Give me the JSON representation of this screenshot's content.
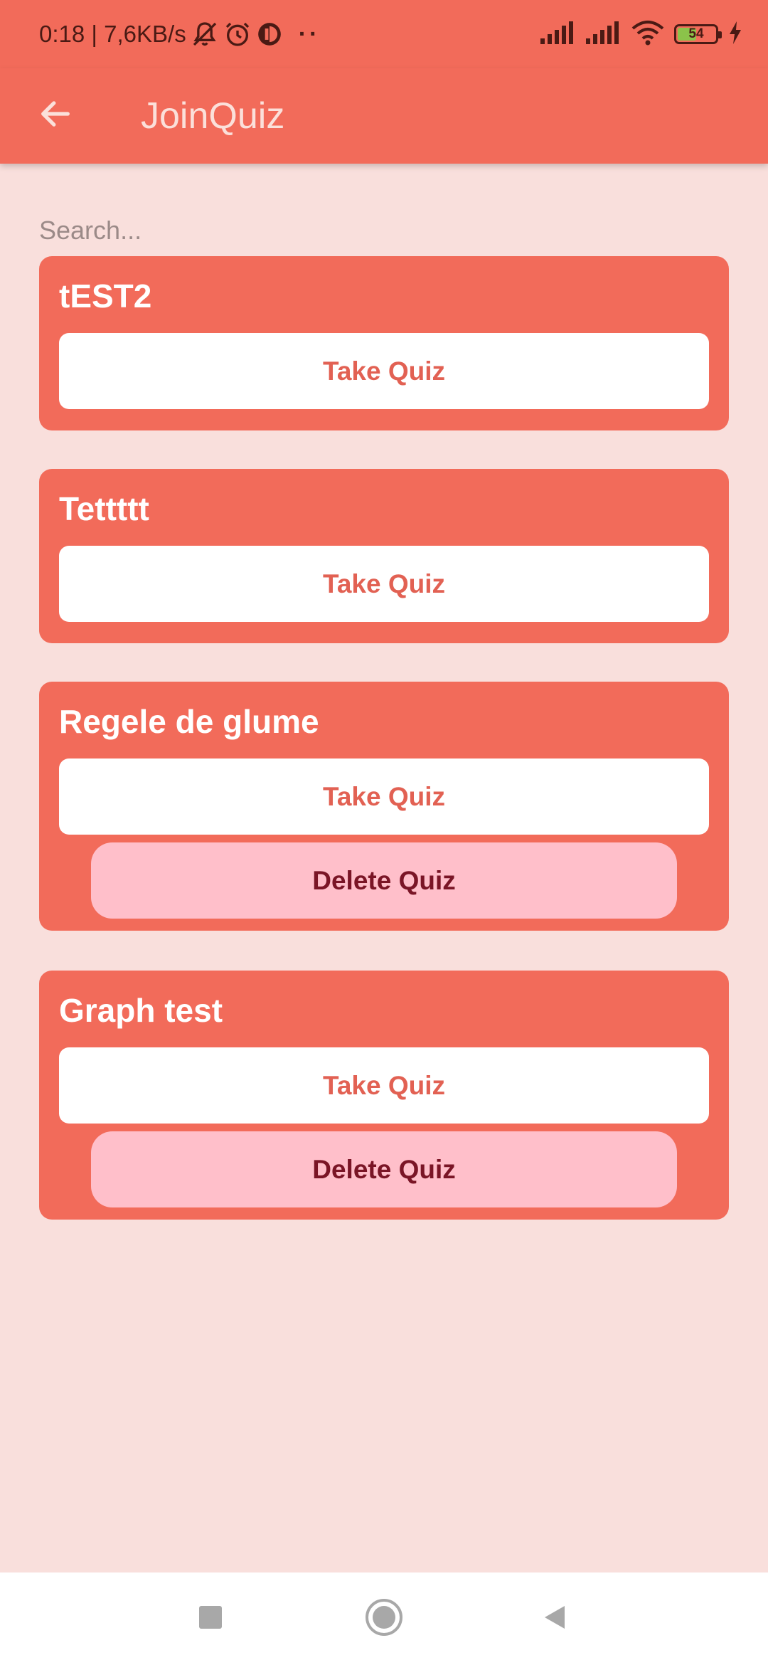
{
  "status_bar": {
    "time_speed": "0:18 | 7,6KB/s",
    "dots": "··",
    "battery": "54",
    "battery_level": 0.54,
    "icons": [
      "bell-off-icon",
      "alarm-icon",
      "app-notification-icon",
      "signal-icon",
      "signal-icon",
      "wifi-icon",
      "battery-icon",
      "charging-icon"
    ]
  },
  "app_bar": {
    "title": "JoinQuiz",
    "back_icon": "arrow-left-icon"
  },
  "search": {
    "placeholder": "Search...",
    "value": ""
  },
  "quizzes": [
    {
      "title": "tEST2",
      "take_label": "Take Quiz"
    },
    {
      "title": "Tettttt",
      "take_label": "Take Quiz"
    },
    {
      "title": "Regele de glume",
      "take_label": "Take Quiz",
      "delete_label": "Delete Quiz"
    },
    {
      "title": "Graph test",
      "take_label": "Take Quiz",
      "delete_label": "Delete Quiz"
    }
  ],
  "nav_bar": {
    "icons": [
      "recents-square-icon",
      "home-circle-icon",
      "back-triangle-icon"
    ]
  },
  "colors": {
    "primary": "#f26b5a",
    "background": "#f9dfdc",
    "take_text": "#e26153",
    "delete_bg": "#ffbfca",
    "delete_text": "#7a1526"
  }
}
